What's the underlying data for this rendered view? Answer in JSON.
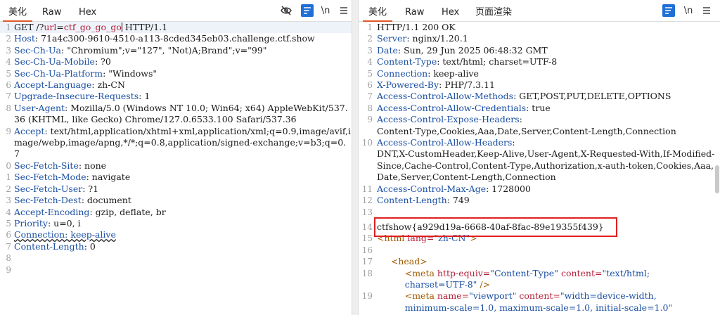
{
  "request_pane": {
    "tabs": [
      "美化",
      "Raw",
      "Hex"
    ],
    "icons": [
      "eye-off-icon",
      "wrap-icon",
      "newline-icon",
      "menu-icon"
    ],
    "lines": [
      {
        "num": "1",
        "parts": [
          {
            "t": "GET /?"
          },
          {
            "t": "url",
            "c": "pn"
          },
          {
            "t": "="
          },
          {
            "t": "ctf_go_go_go",
            "c": "pn"
          },
          {
            "caret": true
          },
          {
            "t": " HTTP/1.1"
          }
        ]
      },
      {
        "num": "2",
        "parts": [
          {
            "t": "Host",
            "c": "hn"
          },
          {
            "t": ": 71a4c300-9610-4510-a113-8cded345eb03.challenge.ctf.show"
          }
        ]
      },
      {
        "num": "3",
        "parts": [
          {
            "t": "Sec-Ch-Ua",
            "c": "hn"
          },
          {
            "t": ": \"Chromium\";v=\"127\", \"Not)A;Brand\";v=\"99\""
          }
        ]
      },
      {
        "num": "4",
        "parts": [
          {
            "t": "Sec-Ch-Ua-Mobile",
            "c": "hn"
          },
          {
            "t": ": ?0"
          }
        ]
      },
      {
        "num": "5",
        "parts": [
          {
            "t": "Sec-Ch-Ua-Platform",
            "c": "hn"
          },
          {
            "t": ": \"Windows\""
          }
        ]
      },
      {
        "num": "6",
        "parts": [
          {
            "t": "Accept-Language",
            "c": "hn"
          },
          {
            "t": ": zh-CN"
          }
        ]
      },
      {
        "num": "7",
        "parts": [
          {
            "t": "Upgrade-Insecure-Requests",
            "c": "hn"
          },
          {
            "t": ": 1"
          }
        ]
      },
      {
        "num": "8",
        "parts": [
          {
            "t": "User-Agent",
            "c": "hn"
          },
          {
            "t": ": Mozilla/5.0 (Windows NT 10.0; Win64; x64) AppleWebKit/537.36 (KHTML, like Gecko) Chrome/127.0.6533.100 Safari/537.36"
          }
        ]
      },
      {
        "num": "9",
        "parts": [
          {
            "t": "Accept",
            "c": "hn"
          },
          {
            "t": ": text/html,application/xhtml+xml,application/xml;q=0.9,image/avif,image/webp,image/apng,*/*;q=0.8,application/signed-exchange;v=b3;q=0.7"
          }
        ]
      },
      {
        "num": "0",
        "parts": [
          {
            "t": "Sec-Fetch-Site",
            "c": "hn"
          },
          {
            "t": ": none"
          }
        ]
      },
      {
        "num": "1",
        "parts": [
          {
            "t": "Sec-Fetch-Mode",
            "c": "hn"
          },
          {
            "t": ": navigate"
          }
        ]
      },
      {
        "num": "2",
        "parts": [
          {
            "t": "Sec-Fetch-User",
            "c": "hn"
          },
          {
            "t": ": ?1"
          }
        ]
      },
      {
        "num": "3",
        "parts": [
          {
            "t": "Sec-Fetch-Dest",
            "c": "hn"
          },
          {
            "t": ": document"
          }
        ]
      },
      {
        "num": "4",
        "parts": [
          {
            "t": "Accept-Encoding",
            "c": "hn"
          },
          {
            "t": ": gzip, deflate, br"
          }
        ]
      },
      {
        "num": "5",
        "parts": [
          {
            "t": "Priority",
            "c": "hn"
          },
          {
            "t": ": u=0, i"
          }
        ]
      },
      {
        "num": "6",
        "parts": [
          {
            "t": "Connection: keep-alive",
            "c": "hn wavy"
          }
        ]
      },
      {
        "num": "7",
        "parts": [
          {
            "t": "Content-Length",
            "c": "hn"
          },
          {
            "t": ": 0"
          }
        ]
      },
      {
        "num": "8",
        "parts": []
      },
      {
        "num": "9",
        "parts": []
      }
    ]
  },
  "response_pane": {
    "tabs": [
      "美化",
      "Raw",
      "Hex",
      "页面渲染"
    ],
    "icons": [
      "wrap-icon",
      "newline-icon",
      "menu-icon"
    ],
    "lines": [
      {
        "num": "1",
        "parts": [
          {
            "t": "HTTP/1.1 200 OK"
          }
        ]
      },
      {
        "num": "2",
        "parts": [
          {
            "t": "Server",
            "c": "hn"
          },
          {
            "t": ": nginx/1.20.1"
          }
        ]
      },
      {
        "num": "3",
        "parts": [
          {
            "t": "Date",
            "c": "hn"
          },
          {
            "t": ": Sun, 29 Jun 2025 06:48:32 GMT"
          }
        ]
      },
      {
        "num": "4",
        "parts": [
          {
            "t": "Content-Type",
            "c": "hn"
          },
          {
            "t": ": text/html; charset=UTF-8"
          }
        ]
      },
      {
        "num": "5",
        "parts": [
          {
            "t": "Connection",
            "c": "hn"
          },
          {
            "t": ": keep-alive"
          }
        ]
      },
      {
        "num": "6",
        "parts": [
          {
            "t": "X-Powered-By",
            "c": "hn"
          },
          {
            "t": ": PHP/7.3.11"
          }
        ]
      },
      {
        "num": "7",
        "parts": [
          {
            "t": "Access-Control-Allow-Methods",
            "c": "hn"
          },
          {
            "t": ": GET,POST,PUT,DELETE,OPTIONS"
          }
        ]
      },
      {
        "num": "8",
        "parts": [
          {
            "t": "Access-Control-Allow-Credentials",
            "c": "hn"
          },
          {
            "t": ": true"
          }
        ]
      },
      {
        "num": "9",
        "parts": [
          {
            "t": "Access-Control-Expose-Headers",
            "c": "hn"
          },
          {
            "t": ":\nContent-Type,Cookies,Aaa,Date,Server,Content-Length,Connection"
          }
        ]
      },
      {
        "num": "10",
        "parts": [
          {
            "t": "Access-Control-Allow-Headers",
            "c": "hn"
          },
          {
            "t": ":\nDNT,X-CustomHeader,Keep-Alive,User-Agent,X-Requested-With,If-Modified-Since,Cache-Control,Content-Type,Authorization,x-auth-token,Cookies,Aaa,Date,Server,Content-Length,Connection"
          }
        ]
      },
      {
        "num": "11",
        "parts": [
          {
            "t": "Access-Control-Max-Age",
            "c": "hn"
          },
          {
            "t": ": 1728000"
          }
        ]
      },
      {
        "num": "12",
        "parts": [
          {
            "t": "Content-Length",
            "c": "hn"
          },
          {
            "t": ": 749"
          }
        ]
      },
      {
        "num": "13",
        "parts": []
      },
      {
        "num": "14",
        "gap": true,
        "parts": [
          {
            "t": "ctfshow{a929d19a-6668-40af-8fac-89e19355f439}"
          }
        ]
      },
      {
        "num": "15",
        "parts": [
          {
            "t": "<html ",
            "c": "tg"
          },
          {
            "t": "lang=",
            "c": "attr"
          },
          {
            "t": "\"zh-CN\"",
            "c": "av"
          },
          {
            "t": ">",
            "c": "tg"
          }
        ]
      },
      {
        "num": "16",
        "parts": []
      },
      {
        "num": "17",
        "parts": [
          {
            "t": "     "
          },
          {
            "t": "<head>",
            "c": "tg"
          }
        ]
      },
      {
        "num": "18",
        "parts": [
          {
            "t": "          "
          },
          {
            "t": "<meta ",
            "c": "tg"
          },
          {
            "t": "http-equiv=",
            "c": "attr"
          },
          {
            "t": "\"Content-Type\"",
            "c": "av"
          },
          {
            "t": " "
          },
          {
            "t": "content=",
            "c": "attr"
          },
          {
            "t": "\"text/html;\n          charset=UTF-8\"",
            "c": "av"
          },
          {
            "t": " />",
            "c": "tg"
          }
        ]
      },
      {
        "num": "19",
        "parts": [
          {
            "t": "          "
          },
          {
            "t": "<meta ",
            "c": "tg"
          },
          {
            "t": "name=",
            "c": "attr"
          },
          {
            "t": "\"viewport\"",
            "c": "av"
          },
          {
            "t": " "
          },
          {
            "t": "content=",
            "c": "attr"
          },
          {
            "t": "\"width=device-width,\n          minimum-scale=1.0, maximum-scale=1.0, initial-scale=1.0\"",
            "c": "av"
          }
        ]
      }
    ]
  }
}
